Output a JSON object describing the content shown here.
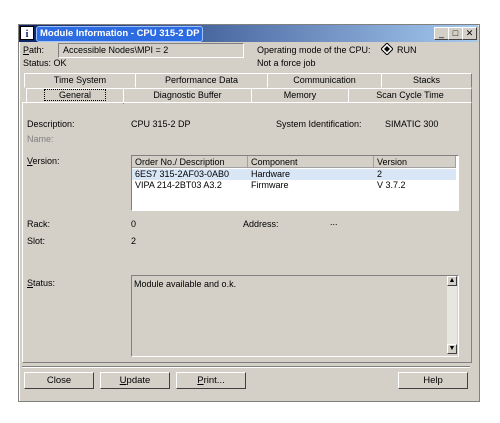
{
  "window": {
    "title": "Module Information - CPU 315-2 DP",
    "controls": [
      "minimize-icon",
      "maximize-icon",
      "close-icon"
    ]
  },
  "header": {
    "path_label": "Path:",
    "path_value": "Accessible Nodes\\MPI = 2",
    "status_label": "Status:",
    "status_value": "OK",
    "operating_mode_label": "Operating mode of the  CPU:",
    "operating_mode_value": "RUN",
    "force_job_text": "Not a force job"
  },
  "tabs_row1": [
    "Time System",
    "Performance Data",
    "Communication",
    "Stacks"
  ],
  "tabs_row2": [
    "General",
    "Diagnostic Buffer",
    "Memory",
    "Scan Cycle Time"
  ],
  "active_tab": "General",
  "general": {
    "description_label": "Description:",
    "description_value": "CPU 315-2 DP",
    "system_id_label": "System Identification:",
    "system_id_value": "SIMATIC 300",
    "name_label": "Name:",
    "version_label": "Version:",
    "version_table": {
      "columns": [
        "Order No./ Description",
        "Component",
        "Version"
      ],
      "rows": [
        [
          "6ES7 315-2AF03-0AB0",
          "Hardware",
          "2"
        ],
        [
          "VIPA 214-2BT03 A3.2",
          "Firmware",
          "V 3.7.2"
        ]
      ]
    },
    "rack_label": "Rack:",
    "rack_value": "0",
    "address_label": "Address:",
    "address_value": "...",
    "slot_label": "Slot:",
    "slot_value": "2",
    "status_label": "Status:",
    "status_text": "Module available and o.k."
  },
  "buttons": {
    "close": "Close",
    "update": "Update",
    "print": "Print...",
    "help": "Help"
  }
}
